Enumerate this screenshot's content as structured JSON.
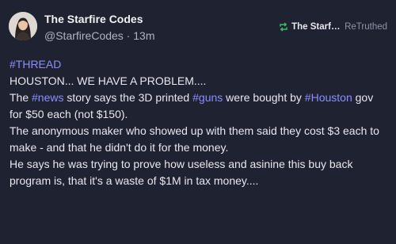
{
  "author": {
    "display_name": "The Starfire Codes",
    "handle": "@StarfireCodes",
    "separator": " · ",
    "time": "13m"
  },
  "retoot": {
    "icon": "retweet-icon",
    "by": "The Starfir...",
    "label": "ReTruthed",
    "accent": "#3fbf6b"
  },
  "post": {
    "hashtag": "#THREAD",
    "p1": "HOUSTON... WE HAVE A PROBLEM....",
    "p2": {
      "t1": "The ",
      "tag1": "#news",
      "t2": " story says the 3D printed ",
      "tag2": "#guns",
      "t3": " were bought by ",
      "tag3": "#Houston",
      "t4": " gov for $50 each (not $150)."
    },
    "p3": "The anonymous maker who showed up with them said they cost $3 each to make - and that he didn't do it for the money.",
    "p4": "He says he was trying to prove how useless and asinine this buy back program is, that it's a waste of $1M in tax money...."
  },
  "colors": {
    "background": "#1f2331",
    "link": "#8c8dff",
    "muted": "#aeb3c4"
  }
}
